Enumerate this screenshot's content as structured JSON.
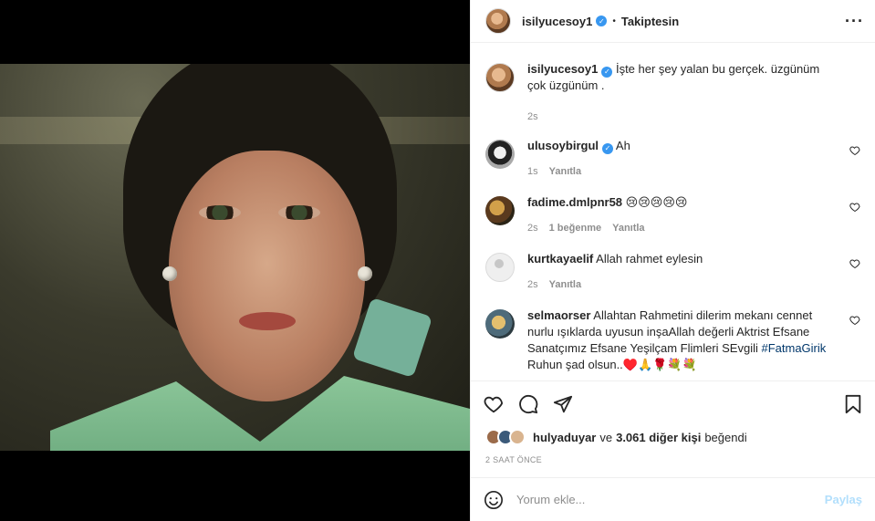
{
  "header": {
    "username": "isilyucesoy1",
    "follow_status": "Takiptesin",
    "more_icon": "more-horizontal-icon"
  },
  "caption": {
    "username": "isilyucesoy1",
    "text": "İşte her şey yalan bu gerçek. üzgünüm çok üzgünüm .",
    "time": "2s"
  },
  "comments": [
    {
      "username": "ulusoybirgul",
      "verified": true,
      "text": "Ah",
      "time": "1s",
      "likes": "",
      "reply": "Yanıtla"
    },
    {
      "username": "fadime.dmlpnr58",
      "verified": false,
      "text": "😢😢😢😢😢",
      "time": "2s",
      "likes": "1 beğenme",
      "reply": "Yanıtla"
    },
    {
      "username": "kurtkayaelif",
      "verified": false,
      "text": "Allah rahmet eylesin",
      "time": "2s",
      "likes": "",
      "reply": "Yanıtla"
    },
    {
      "username": "selmaorser",
      "verified": false,
      "text_before": "Allahtan Rahmetini dilerim mekanı cennet nurlu ışıklarda uyusun inşaAllah değerli Aktrist Efsane Sanatçımız Efsane Yeşilçam Flimleri SEvgili ",
      "hashtag": "#FatmaGirik",
      "text_after": " Ruhun şad olsun..♥️🙏🌹💐💐",
      "time": "",
      "likes": "",
      "reply": ""
    }
  ],
  "likes": {
    "liker": "hulyaduyar",
    "connector": "ve",
    "others": "3.061 diğer kişi",
    "suffix": "beğendi"
  },
  "timestamp": "2 SAAT ÖNCE",
  "composer": {
    "placeholder": "Yorum ekle...",
    "post_label": "Paylaş"
  },
  "colors": {
    "verified": "#3897f0",
    "post_disabled": "#b2dffc",
    "hashtag": "#00376b"
  }
}
